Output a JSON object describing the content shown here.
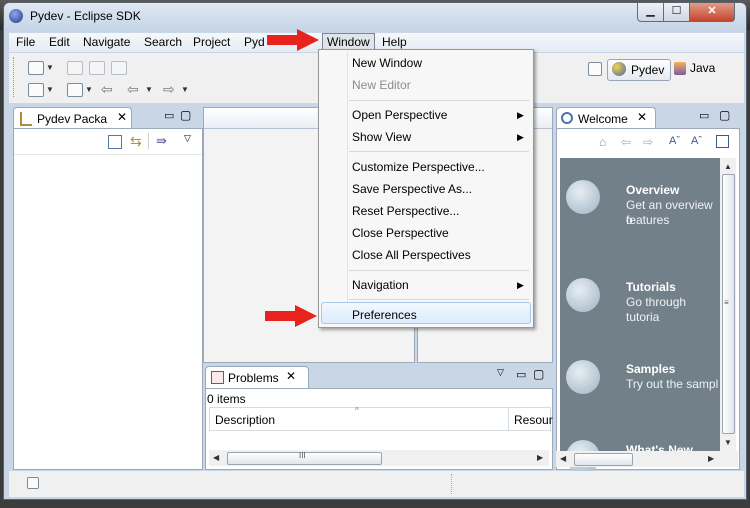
{
  "window": {
    "title": "Pydev - Eclipse SDK",
    "controls": {
      "minimize": "▁",
      "maximize": "☐",
      "close": "✕"
    }
  },
  "menubar": {
    "items": [
      "File",
      "Edit",
      "Navigate",
      "Search",
      "Project",
      "Pyd",
      "Window",
      "Help"
    ],
    "active": "Window"
  },
  "perspectives": {
    "pydev": "Pydev",
    "java": "Java"
  },
  "package_explorer": {
    "tab_label": "Pydev Packa"
  },
  "problems": {
    "tab_label": "Problems",
    "status": "0 items",
    "columns": [
      "Description",
      "Resour"
    ]
  },
  "welcome": {
    "tab_label": "Welcome",
    "items": [
      {
        "title": "Overview",
        "desc": "Get an overview o",
        "desc2": "features"
      },
      {
        "title": "Tutorials",
        "desc": "Go through tutoria"
      },
      {
        "title": "Samples",
        "desc": "Try out the sampl"
      },
      {
        "title": "What's New"
      }
    ]
  },
  "window_menu": {
    "items": [
      {
        "label": "New Window",
        "enabled": true
      },
      {
        "label": "New Editor",
        "enabled": false
      },
      {
        "label": "Open Perspective",
        "submenu": true
      },
      {
        "label": "Show View",
        "submenu": true
      },
      {
        "label": "Customize Perspective..."
      },
      {
        "label": "Save Perspective As..."
      },
      {
        "label": "Reset Perspective..."
      },
      {
        "label": "Close Perspective"
      },
      {
        "label": "Close All Perspectives"
      },
      {
        "label": "Navigation",
        "submenu": true
      },
      {
        "label": "Preferences",
        "highlighted": true
      }
    ]
  },
  "colors": {
    "annotation_arrow": "#e8221c",
    "welcome_background": "#718089",
    "menu_highlight": "#dcebfb"
  }
}
